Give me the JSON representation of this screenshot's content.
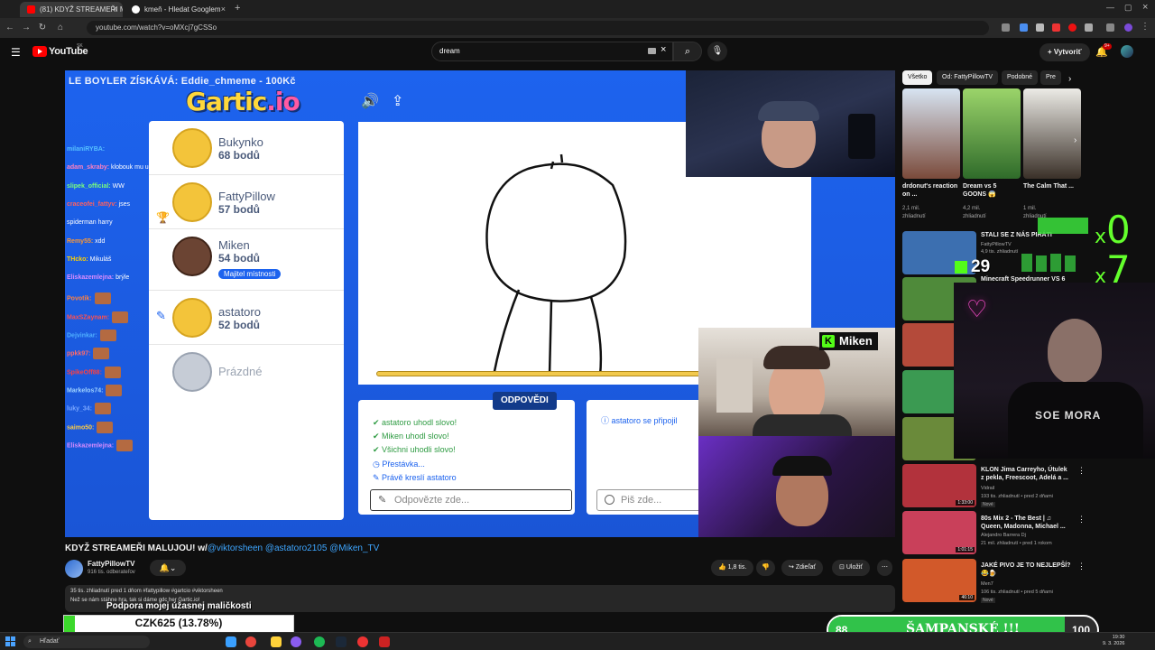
{
  "browser": {
    "tabs": [
      {
        "label": "(81) KDYŽ STREAMEŘI MALUJ",
        "active": true
      },
      {
        "label": "kmeň - Hledat Googlem",
        "active": false
      }
    ],
    "url": "youtube.com/watch?v=oMXcj7gCSSo"
  },
  "youtube": {
    "logo": "YouTube",
    "country": "SK",
    "search_value": "dream",
    "create_label": "Vytvoriť",
    "notif_count": "9+"
  },
  "video": {
    "banner": "LE BOYLER ZÍSKÁVÁ: Eddie_chmeme - 100Kč",
    "gartic_logo": "Gartic",
    "gartic_logo_tld": ".io",
    "players": [
      {
        "name": "Bukynko",
        "score": "68 bodů"
      },
      {
        "name": "FattyPillow",
        "score": "57 bodů"
      },
      {
        "name": "Miken",
        "score": "54 bodů",
        "owner": "Majitel místnosti"
      },
      {
        "name": "astatoro",
        "score": "52 bodů"
      },
      {
        "name": "Prázdné",
        "score": ""
      }
    ],
    "answers_label": "ODPOVĚDI",
    "answers": [
      "astatoro uhodl slovo!",
      "Miken uhodl slovo!",
      "Všichni uhodli slovo!",
      "Přestávka...",
      "Právě kreslí astatoro"
    ],
    "answer_placeholder": "Odpovězte zde...",
    "chat_info": "astatoro se připojil",
    "chat_placeholder": "Piš zde...",
    "cam_label": "Miken",
    "chat": [
      {
        "user": "milaniRYBA:",
        "msg": "",
        "color": "#56c1ff"
      },
      {
        "user": "adam_skraby:",
        "msg": "klobouk mu udelej",
        "color": "#ff80c0"
      },
      {
        "user": "slipek_official:",
        "msg": "WW",
        "color": "#7aff7a"
      },
      {
        "user": "craceofei_fattyv:",
        "msg": "jses",
        "color": "#ff6060"
      },
      {
        "user": "",
        "msg": "spiderman harry",
        "color": "#fff"
      },
      {
        "user": "Remy55:",
        "msg": "xdd",
        "color": "#ff9933"
      },
      {
        "user": "THcko:",
        "msg": "Mikuláš",
        "color": "#ffd000"
      },
      {
        "user": "Eliskazemlejna:",
        "msg": "brýle",
        "color": "#d98cff"
      },
      {
        "user": "Povotik:",
        "msg": "",
        "color": "#ff8040"
      },
      {
        "user": "MaxSZaynam:",
        "msg": "",
        "color": "#ff5050"
      },
      {
        "user": "Dejvinkar:",
        "msg": "",
        "color": "#4fb0ff"
      },
      {
        "user": "ppkk97:",
        "msg": "",
        "color": "#ff6a6a"
      },
      {
        "user": "SpikeOff88:",
        "msg": "",
        "color": "#ff4040"
      },
      {
        "user": "Markelos74:",
        "msg": "",
        "color": "#9fd3ff"
      },
      {
        "user": "luky_34:",
        "msg": "",
        "color": "#79a6ff"
      },
      {
        "user": "saimo50:",
        "msg": "",
        "color": "#ffcc44"
      },
      {
        "user": "Eliskazemlejna:",
        "msg": "",
        "color": "#d98cff"
      }
    ]
  },
  "sidebar": {
    "chips": [
      "Všetko",
      "Od: FattyPillowTV",
      "Podobné",
      "Pre"
    ],
    "shelf": [
      {
        "title": "drdonut's reaction on ...",
        "views": "2,1 mil.",
        "label": "zhliadnutí",
        "color": "#6b3a2c"
      },
      {
        "title": "Dream vs 5 GOONS 😱",
        "views": "4,2 mil.",
        "label": "zhliadnutí",
        "color": "#2f6b2a"
      },
      {
        "title": "The Calm That ...",
        "views": "1 mil.",
        "label": "zhliadnutí",
        "color": "#e9e2d6"
      }
    ],
    "recs": [
      {
        "title": "STALI SE Z NÁS PIRÁTI",
        "channel": "FattyPillowTV",
        "meta": "4,9 tis. zhliadnutí",
        "dur": "",
        "color": "#3c6fb0"
      },
      {
        "title": "Minecraft Speedrunner VS 6 ...",
        "channel": "",
        "meta": "",
        "dur": "",
        "color": "#4f8a3a"
      },
      {
        "title": "",
        "channel": "",
        "meta": "",
        "dur": "",
        "color": "#b44a3a"
      },
      {
        "title": "",
        "channel": "",
        "meta": "",
        "dur": "",
        "color": "#3b9a52"
      },
      {
        "title": "",
        "channel": "",
        "meta": "",
        "dur": "",
        "color": "#6a8a3a"
      },
      {
        "title": "KLON Jima Carreyho, Útulek z pekla, Freescoot, Adelá a ...",
        "channel": "Vidrail",
        "meta": "193 tis. zhliadnutí • pred 2 dňami",
        "dur": "1:33:00",
        "badge": "Nové",
        "color": "#b2323c"
      },
      {
        "title": "80s Mix 2 - The Best | ♫ Queen, Madonna, Michael ...",
        "channel": "Alejandro Barrera Dj",
        "meta": "21 mil. zhliadnutí • pred 1 rokom",
        "dur": "1:01:15",
        "color": "#c9405a"
      },
      {
        "title": "JAKÉ PIVO JE TO NEJLEPŠÍ? 😂🍺",
        "channel": "Men7",
        "meta": "106 tis. zhliadnutí • pred 5 dňami",
        "dur": "46:10",
        "badge": "Nové",
        "color": "#d2592a"
      }
    ],
    "overlay_x0_mult": "x",
    "overlay_x0_num": "0",
    "overlay_x7_mult": "x",
    "overlay_x7_num": "7",
    "overlay_29": "29",
    "cam4_text": "SOE MORA"
  },
  "below": {
    "title_main": "KDYŽ STREAMEŘI MALUJOU! w/",
    "title_tags": "@viktorsheen @astatoro2105 @Miken_TV",
    "channel": "FattyPillowTV",
    "subs": "916 tis. odberateľov",
    "likes": "1,8 tis.",
    "share": "Zdieľať",
    "save": "Uložiť",
    "desc_meta": "35 tis. zhliadnutí  pred 1 dňom  #fattypillow #gartcio #viktorsheen",
    "desc_text": "Než se nám stáhne hra, tak si dáme gdc her Gartic.io!"
  },
  "donation": {
    "label": "Podpora mojej úžasnej maličkosti",
    "goal_text": "CZK625 (13.78%)",
    "progress": 0.1378
  },
  "champagne": {
    "left": "88",
    "label": "ŠAMPANSKÉ !!!",
    "right": "100",
    "progress": 0.88
  },
  "taskbar": {
    "search": "Hľadať",
    "time": "19:30",
    "date": "9. 3. 2026"
  }
}
